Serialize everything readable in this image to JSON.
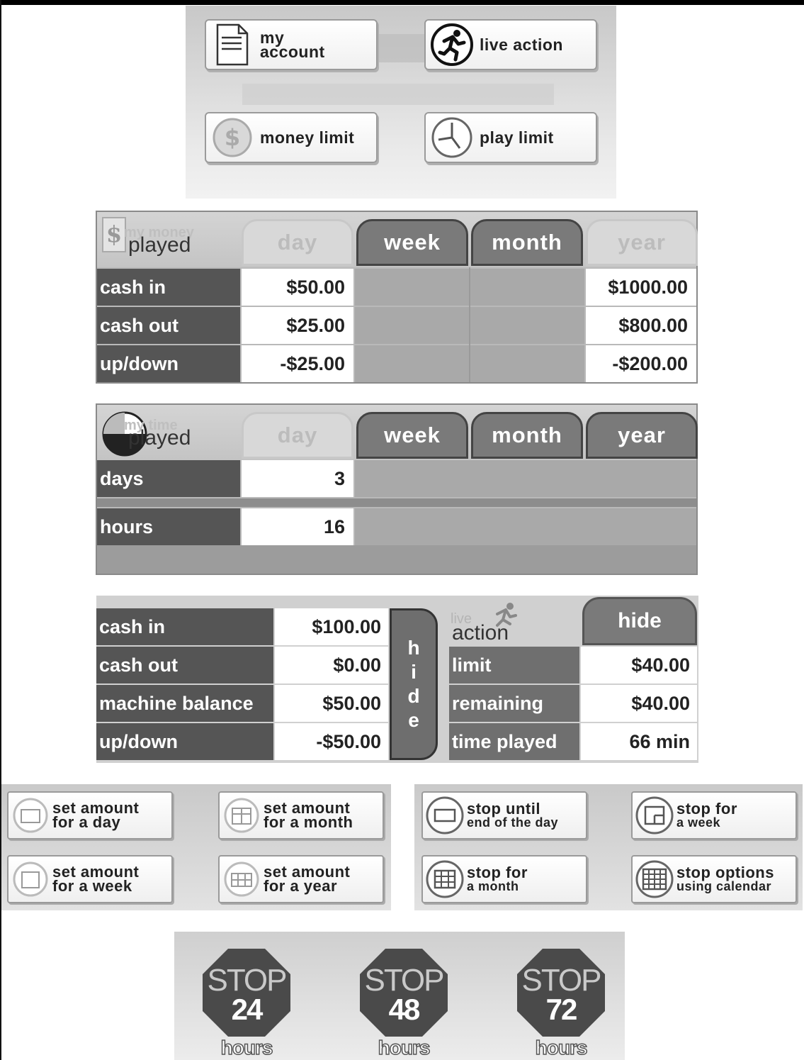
{
  "nav": {
    "my_account": [
      "my",
      "account"
    ],
    "live_action": "live action",
    "money_limit": "money limit",
    "play_limit": "play limit"
  },
  "money_table": {
    "title_small": "my money",
    "title_big": "played",
    "tabs": [
      "day",
      "week",
      "month",
      "year"
    ],
    "rows": [
      {
        "label": "cash in",
        "day": "$50.00",
        "year": "$1000.00"
      },
      {
        "label": "cash out",
        "day": "$25.00",
        "year": "$800.00"
      },
      {
        "label": "up/down",
        "day": "-$25.00",
        "year": "-$200.00"
      }
    ]
  },
  "time_table": {
    "title_small": "my time",
    "title_big": "played",
    "tabs": [
      "day",
      "week",
      "month",
      "year"
    ],
    "rows": [
      {
        "label": "days",
        "day": "3"
      },
      {
        "label": "hours",
        "day": "16"
      }
    ]
  },
  "live_panel": {
    "left_rows": [
      {
        "label": "cash in",
        "value": "$100.00"
      },
      {
        "label": "cash out",
        "value": "$0.00"
      },
      {
        "label": "machine balance",
        "value": "$50.00"
      },
      {
        "label": "up/down",
        "value": "-$50.00"
      }
    ],
    "hide_vertical": [
      "h",
      "i",
      "d",
      "e"
    ],
    "title_small": "live",
    "title_big": "action",
    "hide_tab": "hide",
    "right_rows": [
      {
        "label": "limit",
        "value": "$40.00"
      },
      {
        "label": "remaining",
        "value": "$40.00"
      },
      {
        "label": "time played",
        "value": "66 min"
      }
    ]
  },
  "money_limit_options": [
    {
      "line1": "set amount",
      "line2": "for a day"
    },
    {
      "line1": "set amount",
      "line2": "for a month"
    },
    {
      "line1": "set amount",
      "line2": "for a week"
    },
    {
      "line1": "set amount",
      "line2": "for a year"
    }
  ],
  "play_limit_options": [
    {
      "line1": "stop until",
      "line2": "end of the day"
    },
    {
      "line1": "stop for",
      "line2": "a week"
    },
    {
      "line1": "stop for",
      "line2": "a month"
    },
    {
      "line1": "stop options",
      "line2": "using calendar"
    }
  ],
  "stop_signs": [
    {
      "word": "STOP",
      "number": "24",
      "unit": "hours"
    },
    {
      "word": "STOP",
      "number": "48",
      "unit": "hours"
    },
    {
      "word": "STOP",
      "number": "72",
      "unit": "hours"
    }
  ]
}
